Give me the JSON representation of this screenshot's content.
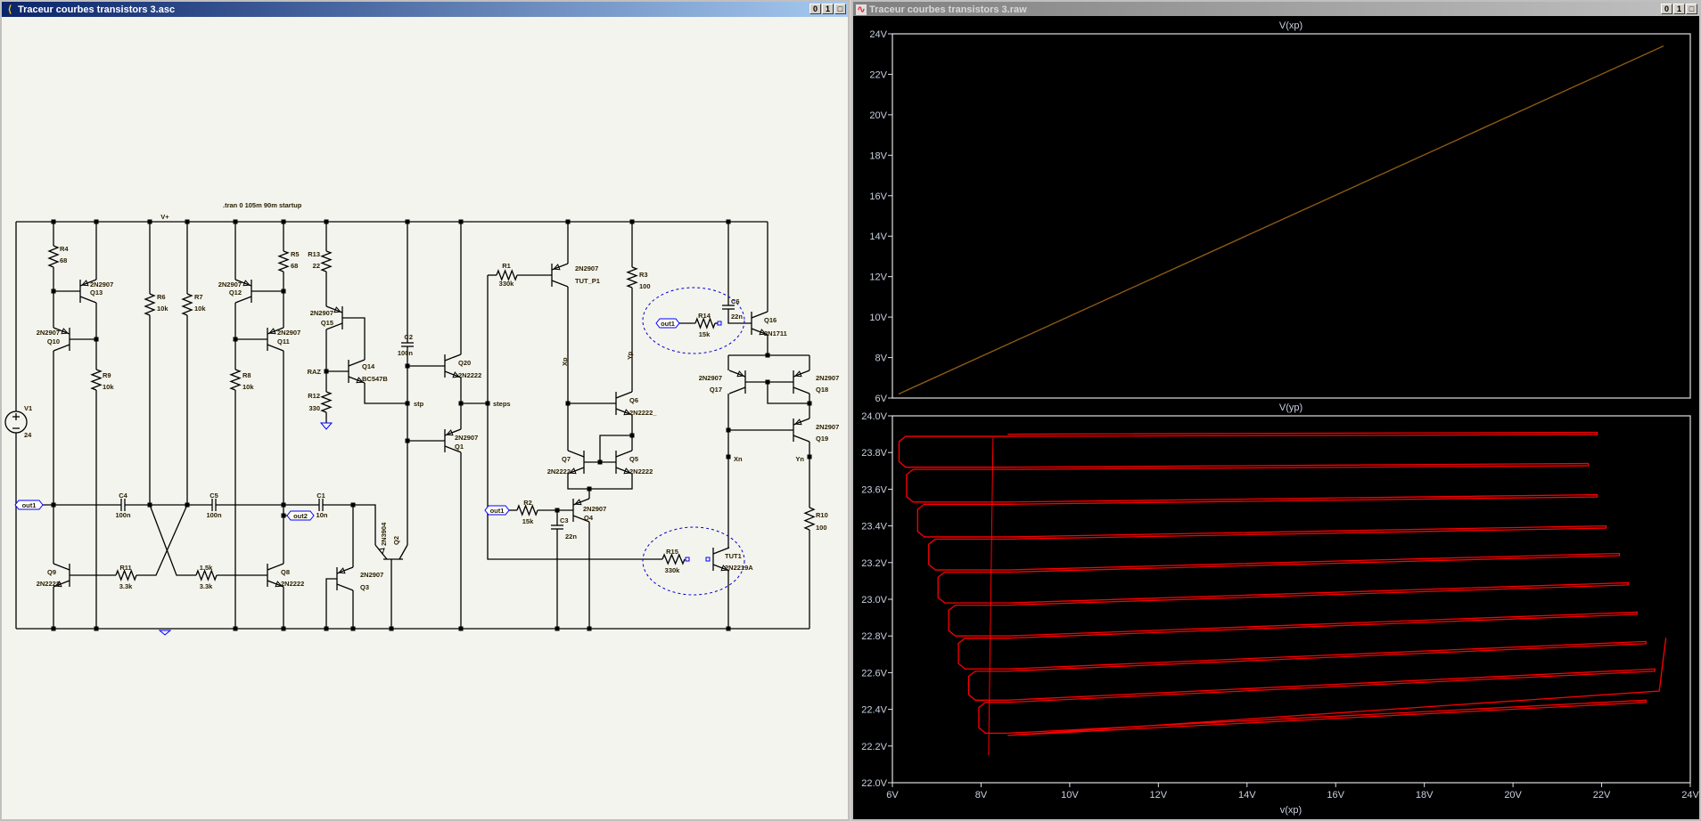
{
  "left_window": {
    "title": "Traceur courbes transistors 3.asc",
    "icon": "schematic-icon"
  },
  "right_window": {
    "title": "Traceur courbes transistors 3.raw",
    "icon": "waveform-icon"
  },
  "window_buttons": {
    "minimize": "0",
    "restore": "1",
    "maximize": "□"
  },
  "schematic": {
    "directive": ".tran 0 105m 90m startup",
    "nets": {
      "vplus": "V+",
      "raz": "RAZ",
      "stp": "stp",
      "steps": "steps",
      "xp": "Xp",
      "yp": "Yp",
      "xn": "Xn",
      "yn": "Yn",
      "out1": "out1",
      "out2": "out2"
    },
    "components": {
      "R4": {
        "ref": "R4",
        "value": "68"
      },
      "R5": {
        "ref": "R5",
        "value": "68"
      },
      "R13": {
        "ref": "R13",
        "value": "22"
      },
      "R6": {
        "ref": "R6",
        "value": "10k"
      },
      "R7": {
        "ref": "R7",
        "value": "10k"
      },
      "R9": {
        "ref": "R9",
        "value": "10k"
      },
      "R8": {
        "ref": "R8",
        "value": "10k"
      },
      "R12": {
        "ref": "R12",
        "value": "330"
      },
      "R11": {
        "ref": "R11",
        "value": "3.3k"
      },
      "RX": {
        "ref": "1.5k",
        "value": "3.3k"
      },
      "R1": {
        "ref": "R1",
        "value": "330k"
      },
      "R2": {
        "ref": "R2",
        "value": "15k"
      },
      "R3": {
        "ref": "R3",
        "value": "100"
      },
      "R10": {
        "ref": "R10",
        "value": "100"
      },
      "R14": {
        "ref": "R14",
        "value": "15k"
      },
      "R15": {
        "ref": "R15",
        "value": "330k"
      },
      "C1": {
        "ref": "C1",
        "value": "10n"
      },
      "C2": {
        "ref": "C2",
        "value": "100n"
      },
      "C3": {
        "ref": "C3",
        "value": "22n"
      },
      "C4": {
        "ref": "C4",
        "value": "100n"
      },
      "C5": {
        "ref": "C5",
        "value": "100n"
      },
      "C6": {
        "ref": "C6",
        "value": "22n"
      },
      "V1": {
        "ref": "V1",
        "value": "24"
      },
      "Q13": {
        "ref": "Q13",
        "value": "2N2907"
      },
      "Q10": {
        "ref": "Q10",
        "value": "2N2907"
      },
      "Q12": {
        "ref": "Q12",
        "value": "2N2907"
      },
      "Q11": {
        "ref": "Q11",
        "value": "2N2907"
      },
      "Q15": {
        "ref": "Q15",
        "value": "2N2907"
      },
      "Q14": {
        "ref": "Q14",
        "value": "BC547B"
      },
      "Q9": {
        "ref": "Q9",
        "value": "2N2222"
      },
      "Q8": {
        "ref": "Q8",
        "value": "2N2222"
      },
      "Q3": {
        "ref": "Q3",
        "value": "2N2907"
      },
      "Q2": {
        "ref": "Q2",
        "value": "2N3904"
      },
      "Q20": {
        "ref": "Q20",
        "value": "2N2222"
      },
      "Q1": {
        "ref": "Q1",
        "value": "2N2907"
      },
      "TUT_P1": {
        "ref": "TUT_P1",
        "value": "2N2907"
      },
      "Q6": {
        "ref": "Q6",
        "value": "2N2222_"
      },
      "Q7": {
        "ref": "Q7",
        "value": "2N2222"
      },
      "Q5": {
        "ref": "Q5",
        "value": "2N2222"
      },
      "Q4": {
        "ref": "Q4",
        "value": "2N2907"
      },
      "Q16": {
        "ref": "Q16",
        "value": "2N1711"
      },
      "Q17": {
        "ref": "Q17",
        "value": "2N2907"
      },
      "Q18": {
        "ref": "Q18",
        "value": "2N2907"
      },
      "Q19": {
        "ref": "Q19",
        "value": "2N2907"
      },
      "TUT1": {
        "ref": "TUT1",
        "value": "2N2219A"
      }
    }
  },
  "chart_data": [
    {
      "type": "line",
      "title": "V(xp)",
      "color": "#8b5a14",
      "ylim": [
        6,
        24
      ],
      "yticks": [
        "6V",
        "8V",
        "10V",
        "12V",
        "14V",
        "16V",
        "18V",
        "20V",
        "22V",
        "24V"
      ],
      "series": [
        {
          "name": "V(xp)",
          "y_start": 6.2,
          "y_end": 23.4
        }
      ]
    },
    {
      "type": "line",
      "title": "V(yp)",
      "color": "#ff0000",
      "xlabel": "v(xp)",
      "xlim": [
        6,
        24
      ],
      "ylim": [
        22.0,
        24.0
      ],
      "xticks": [
        "6V",
        "8V",
        "10V",
        "12V",
        "14V",
        "16V",
        "18V",
        "20V",
        "22V",
        "24V"
      ],
      "yticks": [
        "22.0V",
        "22.2V",
        "22.4V",
        "22.6V",
        "22.8V",
        "23.0V",
        "23.2V",
        "23.4V",
        "23.6V",
        "23.8V",
        "24.0V"
      ],
      "initial_trace": {
        "x": 8.17,
        "y_from": 22.15,
        "y_to": 23.88
      },
      "steps": [
        {
          "x_start": 8.6,
          "y_start": 23.9,
          "x_end": 21.9,
          "y_end": 23.91,
          "hook_x": 6.15
        },
        {
          "x_start": 8.6,
          "y_start": 23.72,
          "x_end": 21.7,
          "y_end": 23.74,
          "hook_x": 6.32
        },
        {
          "x_start": 8.6,
          "y_start": 23.53,
          "x_end": 21.9,
          "y_end": 23.57,
          "hook_x": 6.57
        },
        {
          "x_start": 8.6,
          "y_start": 23.34,
          "x_end": 22.1,
          "y_end": 23.4,
          "hook_x": 6.82
        },
        {
          "x_start": 8.6,
          "y_start": 23.16,
          "x_end": 22.4,
          "y_end": 23.25,
          "hook_x": 7.03
        },
        {
          "x_start": 8.6,
          "y_start": 22.98,
          "x_end": 22.6,
          "y_end": 23.09,
          "hook_x": 7.27
        },
        {
          "x_start": 8.6,
          "y_start": 22.8,
          "x_end": 22.8,
          "y_end": 22.93,
          "hook_x": 7.49
        },
        {
          "x_start": 8.6,
          "y_start": 22.62,
          "x_end": 23.0,
          "y_end": 22.77,
          "hook_x": 7.72
        },
        {
          "x_start": 8.6,
          "y_start": 22.45,
          "x_end": 23.2,
          "y_end": 22.62,
          "hook_x": 7.95
        },
        {
          "x_start": 8.6,
          "y_start": 22.27,
          "x_end": 23.0,
          "y_end": 22.45,
          "hook_x": null
        }
      ],
      "final_rise": {
        "x": 23.45,
        "y": 22.79
      }
    }
  ]
}
